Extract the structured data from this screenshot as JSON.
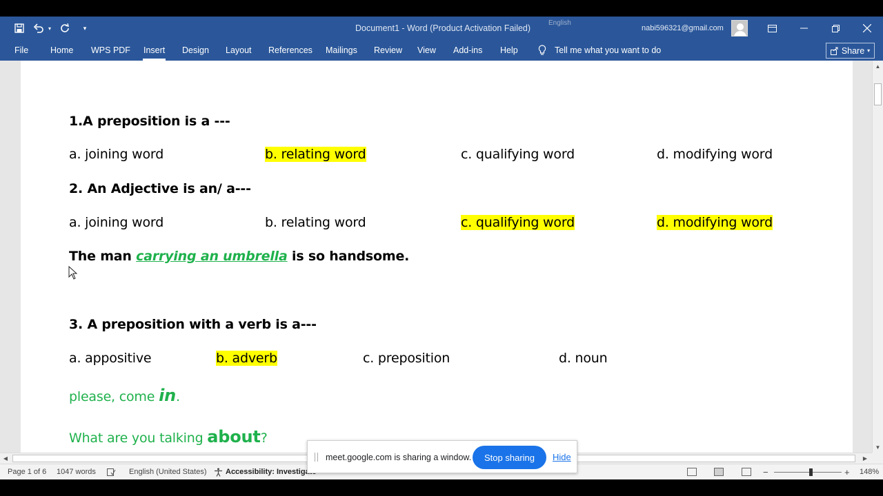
{
  "titlebar": {
    "doc_title": "Document1  -  Word (Product Activation Failed)",
    "account": "nabi596321@gmail.com",
    "ghost_lang": "English"
  },
  "ribbon": {
    "tabs": [
      "File",
      "Home",
      "WPS PDF",
      "Insert",
      "Design",
      "Layout",
      "References",
      "Mailings",
      "Review",
      "View",
      "Add-ins",
      "Help"
    ],
    "active_tab": "Insert",
    "tell_me": "Tell me what you want to do",
    "share": "Share"
  },
  "document": {
    "q1": {
      "question": "1.A preposition is a ---",
      "options": [
        "a. joining word",
        "b. relating word",
        "c. qualifying word",
        "d. modifying word"
      ],
      "highlighted": [
        false,
        true,
        false,
        false
      ]
    },
    "q2": {
      "question": "2. An Adjective is an/ a---",
      "options": [
        "a. joining word",
        "b. relating word",
        "c. qualifying word",
        "d. modifying word"
      ],
      "highlighted": [
        false,
        false,
        true,
        true
      ]
    },
    "example1": {
      "before": "The man ",
      "phrase": "carrying an umbrella",
      "after": " is so handsome."
    },
    "q3": {
      "question": "3. A preposition with a verb is a---",
      "options": [
        "a. appositive",
        "b. adverb",
        "c. preposition",
        "d. noun"
      ],
      "highlighted": [
        false,
        true,
        false,
        false
      ]
    },
    "example2": {
      "before": "please, come ",
      "emph": "in",
      "after": "."
    },
    "example3": {
      "before": "What are you talking ",
      "emph": "about",
      "after": "?"
    }
  },
  "sharing": {
    "message": "meet.google.com is sharing a window.",
    "stop": "Stop sharing",
    "hide": "Hide"
  },
  "status": {
    "page": "Page 1 of 6",
    "words": "1047 words",
    "language": "English (United States)",
    "accessibility": "Accessibility: Investigate",
    "zoom": "148%"
  },
  "colors": {
    "word_blue": "#2b579a",
    "highlight": "#ffff00",
    "green_text": "#1fb14c",
    "meet_blue": "#1a73e8"
  }
}
